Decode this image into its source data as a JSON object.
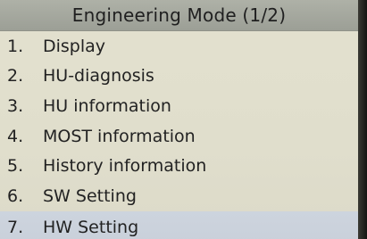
{
  "header": {
    "title": "Engineering Mode (1/2)"
  },
  "menu": {
    "items": [
      {
        "number": "1.",
        "label": "Display"
      },
      {
        "number": "2.",
        "label": "HU-diagnosis"
      },
      {
        "number": "3.",
        "label": "HU information"
      },
      {
        "number": "4.",
        "label": "MOST information"
      },
      {
        "number": "5.",
        "label": "History information"
      },
      {
        "number": "6.",
        "label": "SW Setting"
      },
      {
        "number": "7.",
        "label": "HW Setting"
      }
    ],
    "selected_index": 6
  },
  "colors": {
    "background": "#e0decc",
    "title_bar": "#a4a79e",
    "selection": "#cbd2dc",
    "text": "#222222"
  }
}
